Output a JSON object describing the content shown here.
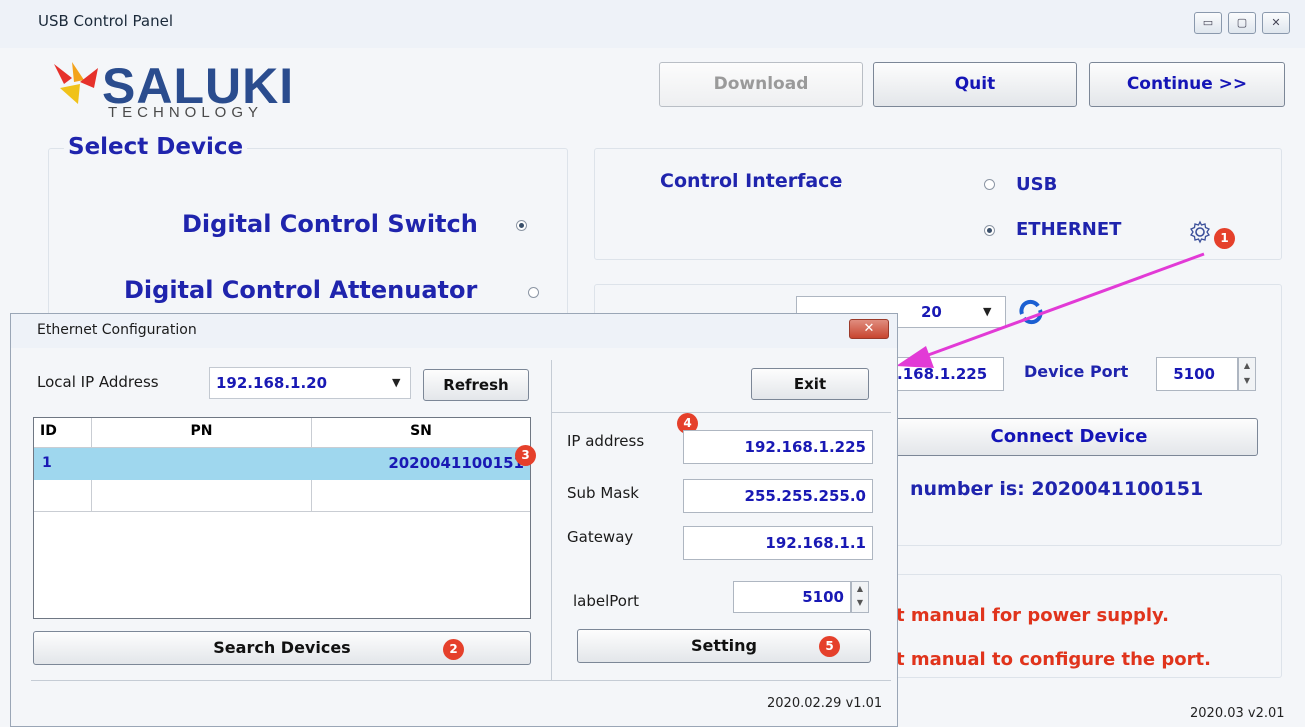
{
  "main": {
    "title": "USB Control Panel",
    "window_buttons": [
      "▭",
      "▢",
      "✕"
    ],
    "logo": {
      "name": "SALUKI",
      "sub": "TECHNOLOGY"
    },
    "toolbar": {
      "download": "Download",
      "quit": "Quit",
      "continue": "Continue >>"
    },
    "select_device": {
      "title": "Select Device",
      "options": [
        {
          "label": "Digital Control Switch",
          "selected": true
        },
        {
          "label": "Digital Control Attenuator",
          "selected": false
        }
      ]
    },
    "control_interface": {
      "label": "Control Interface",
      "options": [
        {
          "label": "USB",
          "selected": false
        },
        {
          "label": "ETHERNET",
          "selected": true
        }
      ],
      "badge": "1"
    },
    "network": {
      "local_ip_partial": "20",
      "device_ip_partial": ".168.1.225",
      "device_port_label": "Device Port",
      "device_port": "5100",
      "connect_button": "Connect Device",
      "serial_partial": "number is: 2020041100151"
    },
    "messages": [
      "t manual for power supply.",
      "t manual to configure the port."
    ],
    "version": "2020.03 v2.01"
  },
  "ethernet": {
    "title": "Ethernet Configuration",
    "close": "✕",
    "local_ip_label": "Local IP Address",
    "local_ip_value": "192.168.1.20",
    "refresh": "Refresh",
    "exit": "Exit",
    "table": {
      "headers": [
        "ID",
        "PN",
        "SN"
      ],
      "rows": [
        {
          "id": "1",
          "pn": "",
          "sn": "2020041100151"
        }
      ]
    },
    "search_button": "Search Devices",
    "fields": {
      "ip_label": "IP address",
      "ip": "192.168.1.225",
      "mask_label": "Sub Mask",
      "mask": "255.255.255.0",
      "gateway_label": "Gateway",
      "gateway": "192.168.1.1",
      "port_label": "labelPort",
      "port": "5100"
    },
    "setting_button": "Setting",
    "version": "2020.02.29 v1.01",
    "badges": [
      "2",
      "3",
      "4",
      "5"
    ]
  },
  "colors": {
    "label_blue": "#1f24ad",
    "value_blue": "#1919b4",
    "warn_red": "#e0341c",
    "badge_red": "#e5402b",
    "arrow_magenta": "#e23ad6",
    "row_highlight": "#9fd7ee"
  }
}
